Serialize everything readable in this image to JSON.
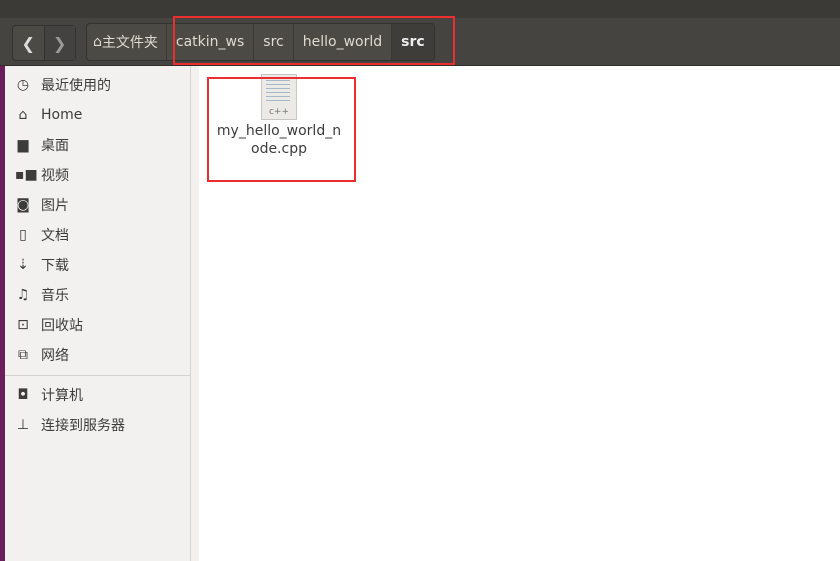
{
  "toolbar": {
    "back_icon": "chevron-left-icon",
    "forward_icon": "chevron-right-icon",
    "breadcrumbs": [
      {
        "label": "主文件夹",
        "icon": "home-icon"
      },
      {
        "label": "catkin_ws"
      },
      {
        "label": "src"
      },
      {
        "label": "hello_world"
      },
      {
        "label": "src",
        "current": true
      }
    ]
  },
  "sidebar": {
    "items": [
      {
        "label": "最近使用的",
        "icon": "clock-icon"
      },
      {
        "label": "Home",
        "icon": "home-icon"
      },
      {
        "label": "桌面",
        "icon": "folder-icon"
      },
      {
        "label": "视频",
        "icon": "video-icon"
      },
      {
        "label": "图片",
        "icon": "camera-icon"
      },
      {
        "label": "文档",
        "icon": "document-icon"
      },
      {
        "label": "下载",
        "icon": "download-icon"
      },
      {
        "label": "音乐",
        "icon": "music-icon"
      },
      {
        "label": "回收站",
        "icon": "trash-icon"
      },
      {
        "label": "网络",
        "icon": "network-icon"
      },
      {
        "label": "计算机",
        "icon": "computer-icon"
      },
      {
        "label": "连接到服务器",
        "icon": "server-icon"
      }
    ]
  },
  "files": [
    {
      "name": "my_hello_world_node.cpp",
      "type_label": "c++"
    }
  ],
  "highlight_color": "#ee2e2e"
}
